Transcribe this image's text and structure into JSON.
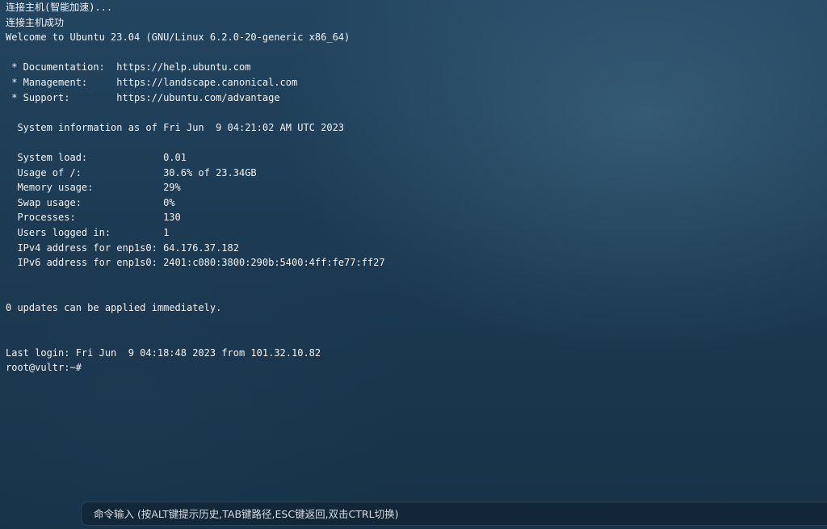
{
  "terminal": {
    "lines": [
      "连接主机(智能加速)...",
      "连接主机成功",
      "Welcome to Ubuntu 23.04 (GNU/Linux 6.2.0-20-generic x86_64)",
      "",
      " * Documentation:  https://help.ubuntu.com",
      " * Management:     https://landscape.canonical.com",
      " * Support:        https://ubuntu.com/advantage",
      "",
      "  System information as of Fri Jun  9 04:21:02 AM UTC 2023",
      "",
      "  System load:             0.01",
      "  Usage of /:              30.6% of 23.34GB",
      "  Memory usage:            29%",
      "  Swap usage:              0%",
      "  Processes:               130",
      "  Users logged in:         1",
      "  IPv4 address for enp1s0: 64.176.37.182",
      "  IPv6 address for enp1s0: 2401:c080:3800:290b:5400:4ff:fe77:ff27",
      "",
      "",
      "0 updates can be applied immediately.",
      "",
      "",
      "Last login: Fri Jun  9 04:18:48 2023 from 101.32.10.82",
      "root@vultr:~#"
    ]
  },
  "command_bar": {
    "placeholder": "命令输入 (按ALT键提示历史,TAB键路径,ESC键返回,双击CTRL切换)"
  }
}
